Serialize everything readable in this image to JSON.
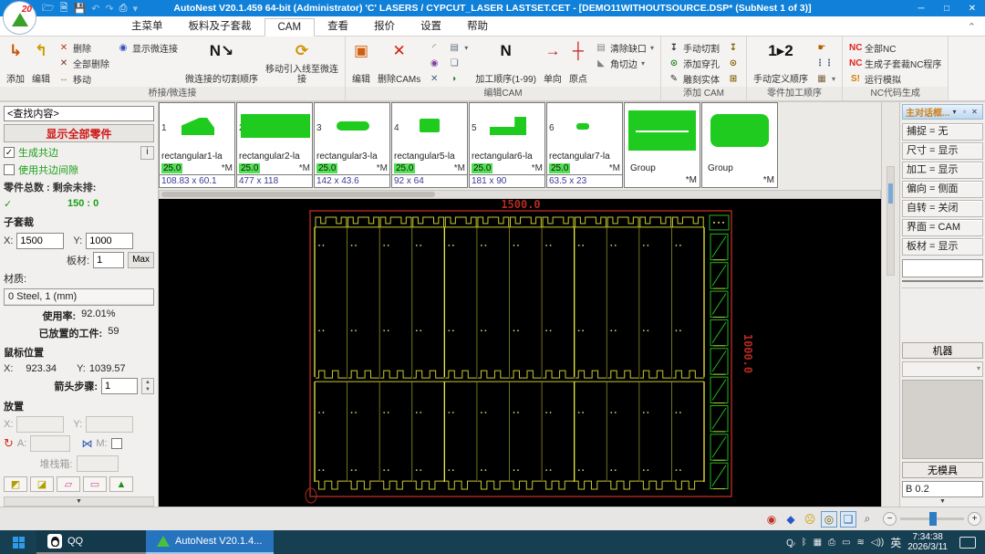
{
  "titlebar": {
    "title": "AutoNest V20.1.459 64-bit (Administrator)    'C'  LASERS / CYPCUT_LASER    LASTSET.CET  -  [DEMO11WITHOUTSOURCE.DSP* (SubNest 1 of 3)]",
    "min": "─",
    "max": "□",
    "close": "✕"
  },
  "menubar": {
    "items": [
      {
        "label": "主菜单",
        "active": false
      },
      {
        "label": "板料及子套裁",
        "active": false
      },
      {
        "label": "CAM",
        "active": true
      },
      {
        "label": "查看",
        "active": false
      },
      {
        "label": "报价",
        "active": false
      },
      {
        "label": "设置",
        "active": false
      },
      {
        "label": "帮助",
        "active": false
      }
    ]
  },
  "ribbon": {
    "groups": [
      {
        "label": "桥接/微连接",
        "cols": [
          {
            "type": "large",
            "label": "添加",
            "icon": "bridge-add"
          },
          {
            "type": "large",
            "label": "编辑",
            "icon": "bridge-edit"
          },
          {
            "type": "stack",
            "items": [
              {
                "label": "删除",
                "icon": "delete"
              },
              {
                "label": "全部删除",
                "icon": "delete-all"
              },
              {
                "label": "移动",
                "icon": "move"
              }
            ]
          },
          {
            "type": "stack",
            "items": [
              {
                "label": "显示微连接",
                "icon": "show-microjoint"
              }
            ]
          },
          {
            "type": "large",
            "label": "微连接的切割顺序",
            "icon": "microjoint-cut-order"
          },
          {
            "type": "large",
            "label": "移动引入线至微连接",
            "icon": "move-leadin"
          }
        ]
      },
      {
        "label": "编辑CAM",
        "cols": [
          {
            "type": "large",
            "label": "编辑",
            "icon": "cam-edit"
          },
          {
            "type": "large",
            "label": "删除CAMs",
            "icon": "cam-delete"
          },
          {
            "type": "stack",
            "items": [
              {
                "label": "",
                "icon": "leadin-curve"
              },
              {
                "label": "",
                "icon": "leadin-face"
              },
              {
                "label": "",
                "icon": "leadin-cut"
              }
            ]
          },
          {
            "type": "stack",
            "items": [
              {
                "label": "",
                "icon": "grid-list",
                "arrow": true
              },
              {
                "label": "",
                "icon": "copy-cam"
              },
              {
                "label": "",
                "icon": "leaf"
              }
            ]
          },
          {
            "type": "large",
            "label": "加工顺序(1-99)",
            "icon": "order-hammer"
          },
          {
            "type": "large",
            "label": "单向",
            "icon": "one-way"
          },
          {
            "type": "large",
            "label": "原点",
            "icon": "origin"
          },
          {
            "type": "stack",
            "items": [
              {
                "label": "清除缺口",
                "icon": "clear-notch",
                "arrow": true
              },
              {
                "label": "角切边",
                "icon": "corner-trim",
                "arrow": true
              }
            ]
          }
        ]
      },
      {
        "label": "添加 CAM",
        "cols": [
          {
            "type": "stack",
            "items": [
              {
                "label": "手动切割",
                "icon": "manual-cut"
              },
              {
                "label": "添加穿孔",
                "icon": "add-pierce"
              },
              {
                "label": "雕刻实体",
                "icon": "engrave"
              }
            ]
          },
          {
            "type": "stack",
            "items": [
              {
                "label": "",
                "icon": "cut-abc"
              },
              {
                "label": "",
                "icon": "pierce-abc"
              },
              {
                "label": "",
                "icon": "engrave-abc"
              }
            ]
          }
        ]
      },
      {
        "label": "零件加工顺序",
        "cols": [
          {
            "type": "large",
            "label": "手动定义顺序",
            "icon": "manual-order"
          },
          {
            "type": "stack",
            "items": [
              {
                "label": "",
                "icon": "order-hand"
              },
              {
                "label": "",
                "icon": "order-list"
              },
              {
                "label": "",
                "icon": "order-grid",
                "arrow": true
              }
            ]
          }
        ]
      },
      {
        "label": "NC代码生成",
        "cols": [
          {
            "type": "stack",
            "items": [
              {
                "label": "全部NC",
                "icon": "nc-all"
              },
              {
                "label": "生成子套裁NC程序",
                "icon": "nc-subnest"
              },
              {
                "label": "运行模拟",
                "icon": "simulate"
              }
            ]
          }
        ]
      }
    ]
  },
  "parts": [
    {
      "num": "1",
      "name": "rectangular1-la",
      "qty": "25.0",
      "flag": "*M",
      "dims": "108.83 x 60.1",
      "shape": "wedge",
      "group": false
    },
    {
      "num": "2",
      "name": "rectangular2-la",
      "qty": "25.0",
      "flag": "*M",
      "dims": "477 x 118",
      "shape": "wide",
      "group": false
    },
    {
      "num": "3",
      "name": "rectangular3-la",
      "qty": "25.0",
      "flag": "*M",
      "dims": "142 x 43.6",
      "shape": "pill",
      "group": false
    },
    {
      "num": "4",
      "name": "rectangular5-la",
      "qty": "25.0",
      "flag": "*M",
      "dims": "92 x 64",
      "shape": "small",
      "group": false
    },
    {
      "num": "5",
      "name": "rectangular6-la",
      "qty": "25.0",
      "flag": "*M",
      "dims": "181 x 90",
      "shape": "lshape",
      "group": false
    },
    {
      "num": "6",
      "name": "rectangular7-la",
      "qty": "25.0",
      "flag": "*M",
      "dims": "63.5 x 23",
      "shape": "tiny",
      "group": false
    },
    {
      "num": "",
      "name": "Group",
      "qty": "",
      "flag": "*M",
      "dims": "",
      "shape": "group1",
      "group": true
    },
    {
      "num": "",
      "name": "Group",
      "qty": "",
      "flag": "*M",
      "dims": "",
      "shape": "group2",
      "group": true
    }
  ],
  "sidebar": {
    "search_value": "<查找内容>",
    "show_all_label": "显示全部零件",
    "cb_common_edge": {
      "label": "生成共边",
      "checked": true,
      "info": "i"
    },
    "cb_gap": {
      "label": "使用共边间隙",
      "checked": false
    },
    "totals_label": "零件总数 : 剩余未排:",
    "totals_check": "✓",
    "totals_value": "150 : 0",
    "subnest": {
      "title": "子套裁",
      "x_label": "X:",
      "x": "1500",
      "y_label": "Y:",
      "y": "1000",
      "sheet_label": "板材:",
      "sheet": "1",
      "max_label": "Max"
    },
    "material_label": "材质:",
    "material_value": "0  Steel, 1 (mm)",
    "usage_label": "使用率:",
    "usage_value": "92.01%",
    "placed_label": "已放置的工件:",
    "placed_value": "59",
    "mouse": {
      "title": "鼠标位置",
      "x_label": "X:",
      "x": "923.34",
      "y_label": "Y:",
      "y": "1039.57",
      "step_label": "箭头步骤:",
      "step": "1"
    },
    "placement": {
      "title": "放置",
      "x_label": "X:",
      "y_label": "Y:",
      "a_label": "A:",
      "m_label": "M:",
      "stack_label": "堆栈箱:"
    }
  },
  "canvas": {
    "width_label": "1500.0",
    "height_label": "1000.0",
    "columns": 12,
    "right_parts": 9,
    "sheet_color": "#b42a20",
    "part_color": "#c8c830",
    "green_color": "#22b822"
  },
  "right_panel": {
    "title": "主对话框...",
    "btn_drop": "▾",
    "btn_pin": "▫",
    "btn_close": "✕",
    "rows": [
      "捕捉 = 无",
      "尺寸 = 显示",
      "加工 = 显示",
      "偏向 = 侧面",
      "自转 = 关闭",
      "界面 = CAM",
      "板材 = 显示"
    ],
    "machine_label": "机器",
    "nodie_label": "无模具",
    "field_value": "B 0.2"
  },
  "status": {
    "view_icons": [
      {
        "name": "nest-result-icon",
        "glyph": "◉",
        "color": "#c03028",
        "sel": false
      },
      {
        "name": "gem-icon",
        "glyph": "◆",
        "color": "#2858c8",
        "sel": false
      },
      {
        "name": "face-icon",
        "glyph": "☹",
        "color": "#c8a000",
        "sel": false
      },
      {
        "name": "record-icon",
        "glyph": "◎",
        "color": "#806000",
        "sel": true
      },
      {
        "name": "layers-icon",
        "glyph": "❏",
        "color": "#3068b0",
        "sel": true
      },
      {
        "name": "magnifier-icon",
        "glyph": "⌕",
        "color": "#555555",
        "sel": false
      }
    ],
    "zoom_minus": "−",
    "zoom_plus": "+"
  },
  "taskbar": {
    "qq_label": "QQ",
    "app_label": "AutoNest V20.1.4...",
    "tray": [
      {
        "name": "qq-tray-icon",
        "glyph": "Ꝙ"
      },
      {
        "name": "bluetooth-icon",
        "glyph": "ᛒ"
      },
      {
        "name": "blue-app-icon",
        "glyph": "▦"
      },
      {
        "name": "usb-icon",
        "glyph": "⎙"
      },
      {
        "name": "battery-icon",
        "glyph": "▭"
      },
      {
        "name": "wifi-icon",
        "glyph": "≋"
      },
      {
        "name": "speaker-icon",
        "glyph": "◁))"
      }
    ],
    "ime": "英",
    "time": "7:34:38",
    "date": "2026/3/11"
  }
}
